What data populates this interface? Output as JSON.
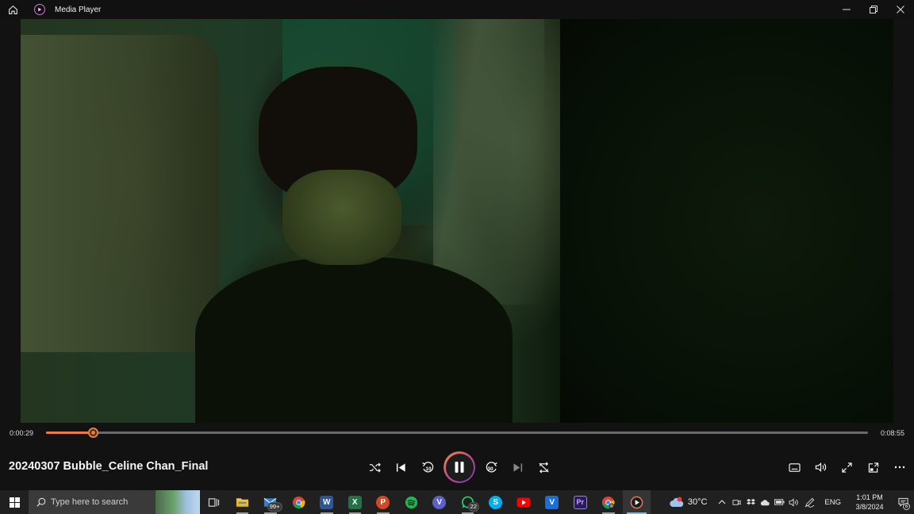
{
  "window": {
    "title": "Media Player",
    "controls": [
      "minimize",
      "restore",
      "close"
    ]
  },
  "player": {
    "current_time": "0:00:29",
    "total_time": "0:08:55",
    "progress_fraction": 0.0573,
    "track_title": "20240307 Bubble_Celine Chan_Final",
    "skip_back_seconds": "10",
    "skip_forward_seconds": "30",
    "state": "playing",
    "accent_color": "#f07c3a"
  },
  "taskbar": {
    "search_placeholder": "Type here to search",
    "apps": [
      {
        "name": "task-view",
        "icon": "task-view-icon"
      },
      {
        "name": "file-explorer",
        "icon": "folder-icon",
        "color": "#f2c94c"
      },
      {
        "name": "mail",
        "icon": "mail-icon",
        "badge": "99+"
      },
      {
        "name": "chrome",
        "icon": "chrome-icon"
      },
      {
        "name": "word",
        "icon": "word-icon",
        "color": "#2b579a"
      },
      {
        "name": "excel",
        "icon": "excel-icon",
        "color": "#217346"
      },
      {
        "name": "powerpoint",
        "icon": "powerpoint-icon",
        "color": "#d24726"
      },
      {
        "name": "spotify",
        "icon": "spotify-icon",
        "color": "#1db954"
      },
      {
        "name": "viber",
        "icon": "viber-icon",
        "color": "#5b61c9"
      },
      {
        "name": "whatsapp",
        "icon": "whatsapp-icon",
        "color": "#25d366",
        "badge": "22"
      },
      {
        "name": "skype",
        "icon": "skype-icon",
        "color": "#00aff0"
      },
      {
        "name": "youtube",
        "icon": "youtube-icon",
        "color": "#ff0000"
      },
      {
        "name": "vimeo",
        "icon": "vimeo-icon",
        "color": "#1a6ed8"
      },
      {
        "name": "premiere-pro",
        "icon": "premiere-icon",
        "color": "#2a1a5e"
      },
      {
        "name": "chrome-profile",
        "icon": "chrome-icon"
      },
      {
        "name": "media-player",
        "icon": "media-player-icon"
      }
    ],
    "weather": {
      "temp": "30°C",
      "alert": "1"
    },
    "language": "ENG",
    "time": "1:01 PM",
    "date": "3/8/2024",
    "notification_count": "6"
  }
}
